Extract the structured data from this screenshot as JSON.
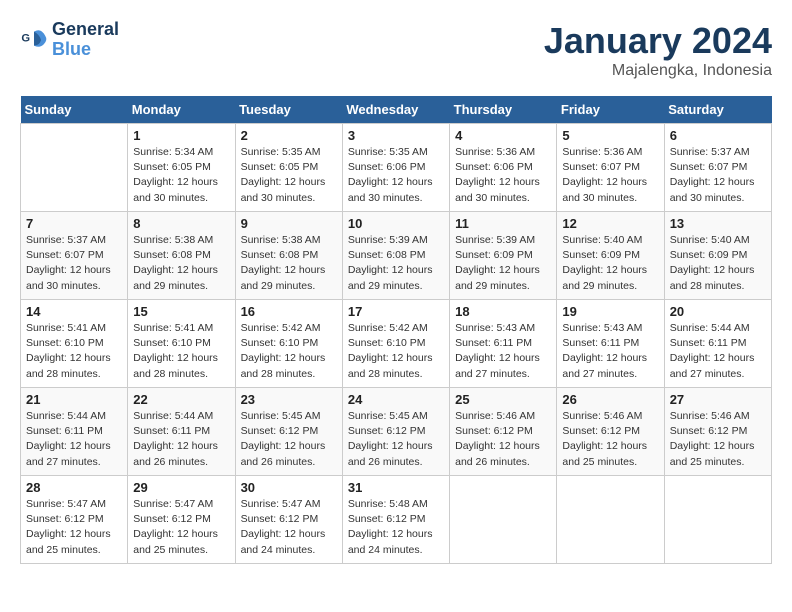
{
  "logo": {
    "line1": "General",
    "line2": "Blue"
  },
  "title": "January 2024",
  "subtitle": "Majalengka, Indonesia",
  "days_header": [
    "Sunday",
    "Monday",
    "Tuesday",
    "Wednesday",
    "Thursday",
    "Friday",
    "Saturday"
  ],
  "weeks": [
    [
      {
        "day": "",
        "info": ""
      },
      {
        "day": "1",
        "info": "Sunrise: 5:34 AM\nSunset: 6:05 PM\nDaylight: 12 hours\nand 30 minutes."
      },
      {
        "day": "2",
        "info": "Sunrise: 5:35 AM\nSunset: 6:05 PM\nDaylight: 12 hours\nand 30 minutes."
      },
      {
        "day": "3",
        "info": "Sunrise: 5:35 AM\nSunset: 6:06 PM\nDaylight: 12 hours\nand 30 minutes."
      },
      {
        "day": "4",
        "info": "Sunrise: 5:36 AM\nSunset: 6:06 PM\nDaylight: 12 hours\nand 30 minutes."
      },
      {
        "day": "5",
        "info": "Sunrise: 5:36 AM\nSunset: 6:07 PM\nDaylight: 12 hours\nand 30 minutes."
      },
      {
        "day": "6",
        "info": "Sunrise: 5:37 AM\nSunset: 6:07 PM\nDaylight: 12 hours\nand 30 minutes."
      }
    ],
    [
      {
        "day": "7",
        "info": "Sunrise: 5:37 AM\nSunset: 6:07 PM\nDaylight: 12 hours\nand 30 minutes."
      },
      {
        "day": "8",
        "info": "Sunrise: 5:38 AM\nSunset: 6:08 PM\nDaylight: 12 hours\nand 29 minutes."
      },
      {
        "day": "9",
        "info": "Sunrise: 5:38 AM\nSunset: 6:08 PM\nDaylight: 12 hours\nand 29 minutes."
      },
      {
        "day": "10",
        "info": "Sunrise: 5:39 AM\nSunset: 6:08 PM\nDaylight: 12 hours\nand 29 minutes."
      },
      {
        "day": "11",
        "info": "Sunrise: 5:39 AM\nSunset: 6:09 PM\nDaylight: 12 hours\nand 29 minutes."
      },
      {
        "day": "12",
        "info": "Sunrise: 5:40 AM\nSunset: 6:09 PM\nDaylight: 12 hours\nand 29 minutes."
      },
      {
        "day": "13",
        "info": "Sunrise: 5:40 AM\nSunset: 6:09 PM\nDaylight: 12 hours\nand 28 minutes."
      }
    ],
    [
      {
        "day": "14",
        "info": "Sunrise: 5:41 AM\nSunset: 6:10 PM\nDaylight: 12 hours\nand 28 minutes."
      },
      {
        "day": "15",
        "info": "Sunrise: 5:41 AM\nSunset: 6:10 PM\nDaylight: 12 hours\nand 28 minutes."
      },
      {
        "day": "16",
        "info": "Sunrise: 5:42 AM\nSunset: 6:10 PM\nDaylight: 12 hours\nand 28 minutes."
      },
      {
        "day": "17",
        "info": "Sunrise: 5:42 AM\nSunset: 6:10 PM\nDaylight: 12 hours\nand 28 minutes."
      },
      {
        "day": "18",
        "info": "Sunrise: 5:43 AM\nSunset: 6:11 PM\nDaylight: 12 hours\nand 27 minutes."
      },
      {
        "day": "19",
        "info": "Sunrise: 5:43 AM\nSunset: 6:11 PM\nDaylight: 12 hours\nand 27 minutes."
      },
      {
        "day": "20",
        "info": "Sunrise: 5:44 AM\nSunset: 6:11 PM\nDaylight: 12 hours\nand 27 minutes."
      }
    ],
    [
      {
        "day": "21",
        "info": "Sunrise: 5:44 AM\nSunset: 6:11 PM\nDaylight: 12 hours\nand 27 minutes."
      },
      {
        "day": "22",
        "info": "Sunrise: 5:44 AM\nSunset: 6:11 PM\nDaylight: 12 hours\nand 26 minutes."
      },
      {
        "day": "23",
        "info": "Sunrise: 5:45 AM\nSunset: 6:12 PM\nDaylight: 12 hours\nand 26 minutes."
      },
      {
        "day": "24",
        "info": "Sunrise: 5:45 AM\nSunset: 6:12 PM\nDaylight: 12 hours\nand 26 minutes."
      },
      {
        "day": "25",
        "info": "Sunrise: 5:46 AM\nSunset: 6:12 PM\nDaylight: 12 hours\nand 26 minutes."
      },
      {
        "day": "26",
        "info": "Sunrise: 5:46 AM\nSunset: 6:12 PM\nDaylight: 12 hours\nand 25 minutes."
      },
      {
        "day": "27",
        "info": "Sunrise: 5:46 AM\nSunset: 6:12 PM\nDaylight: 12 hours\nand 25 minutes."
      }
    ],
    [
      {
        "day": "28",
        "info": "Sunrise: 5:47 AM\nSunset: 6:12 PM\nDaylight: 12 hours\nand 25 minutes."
      },
      {
        "day": "29",
        "info": "Sunrise: 5:47 AM\nSunset: 6:12 PM\nDaylight: 12 hours\nand 25 minutes."
      },
      {
        "day": "30",
        "info": "Sunrise: 5:47 AM\nSunset: 6:12 PM\nDaylight: 12 hours\nand 24 minutes."
      },
      {
        "day": "31",
        "info": "Sunrise: 5:48 AM\nSunset: 6:12 PM\nDaylight: 12 hours\nand 24 minutes."
      },
      {
        "day": "",
        "info": ""
      },
      {
        "day": "",
        "info": ""
      },
      {
        "day": "",
        "info": ""
      }
    ]
  ]
}
